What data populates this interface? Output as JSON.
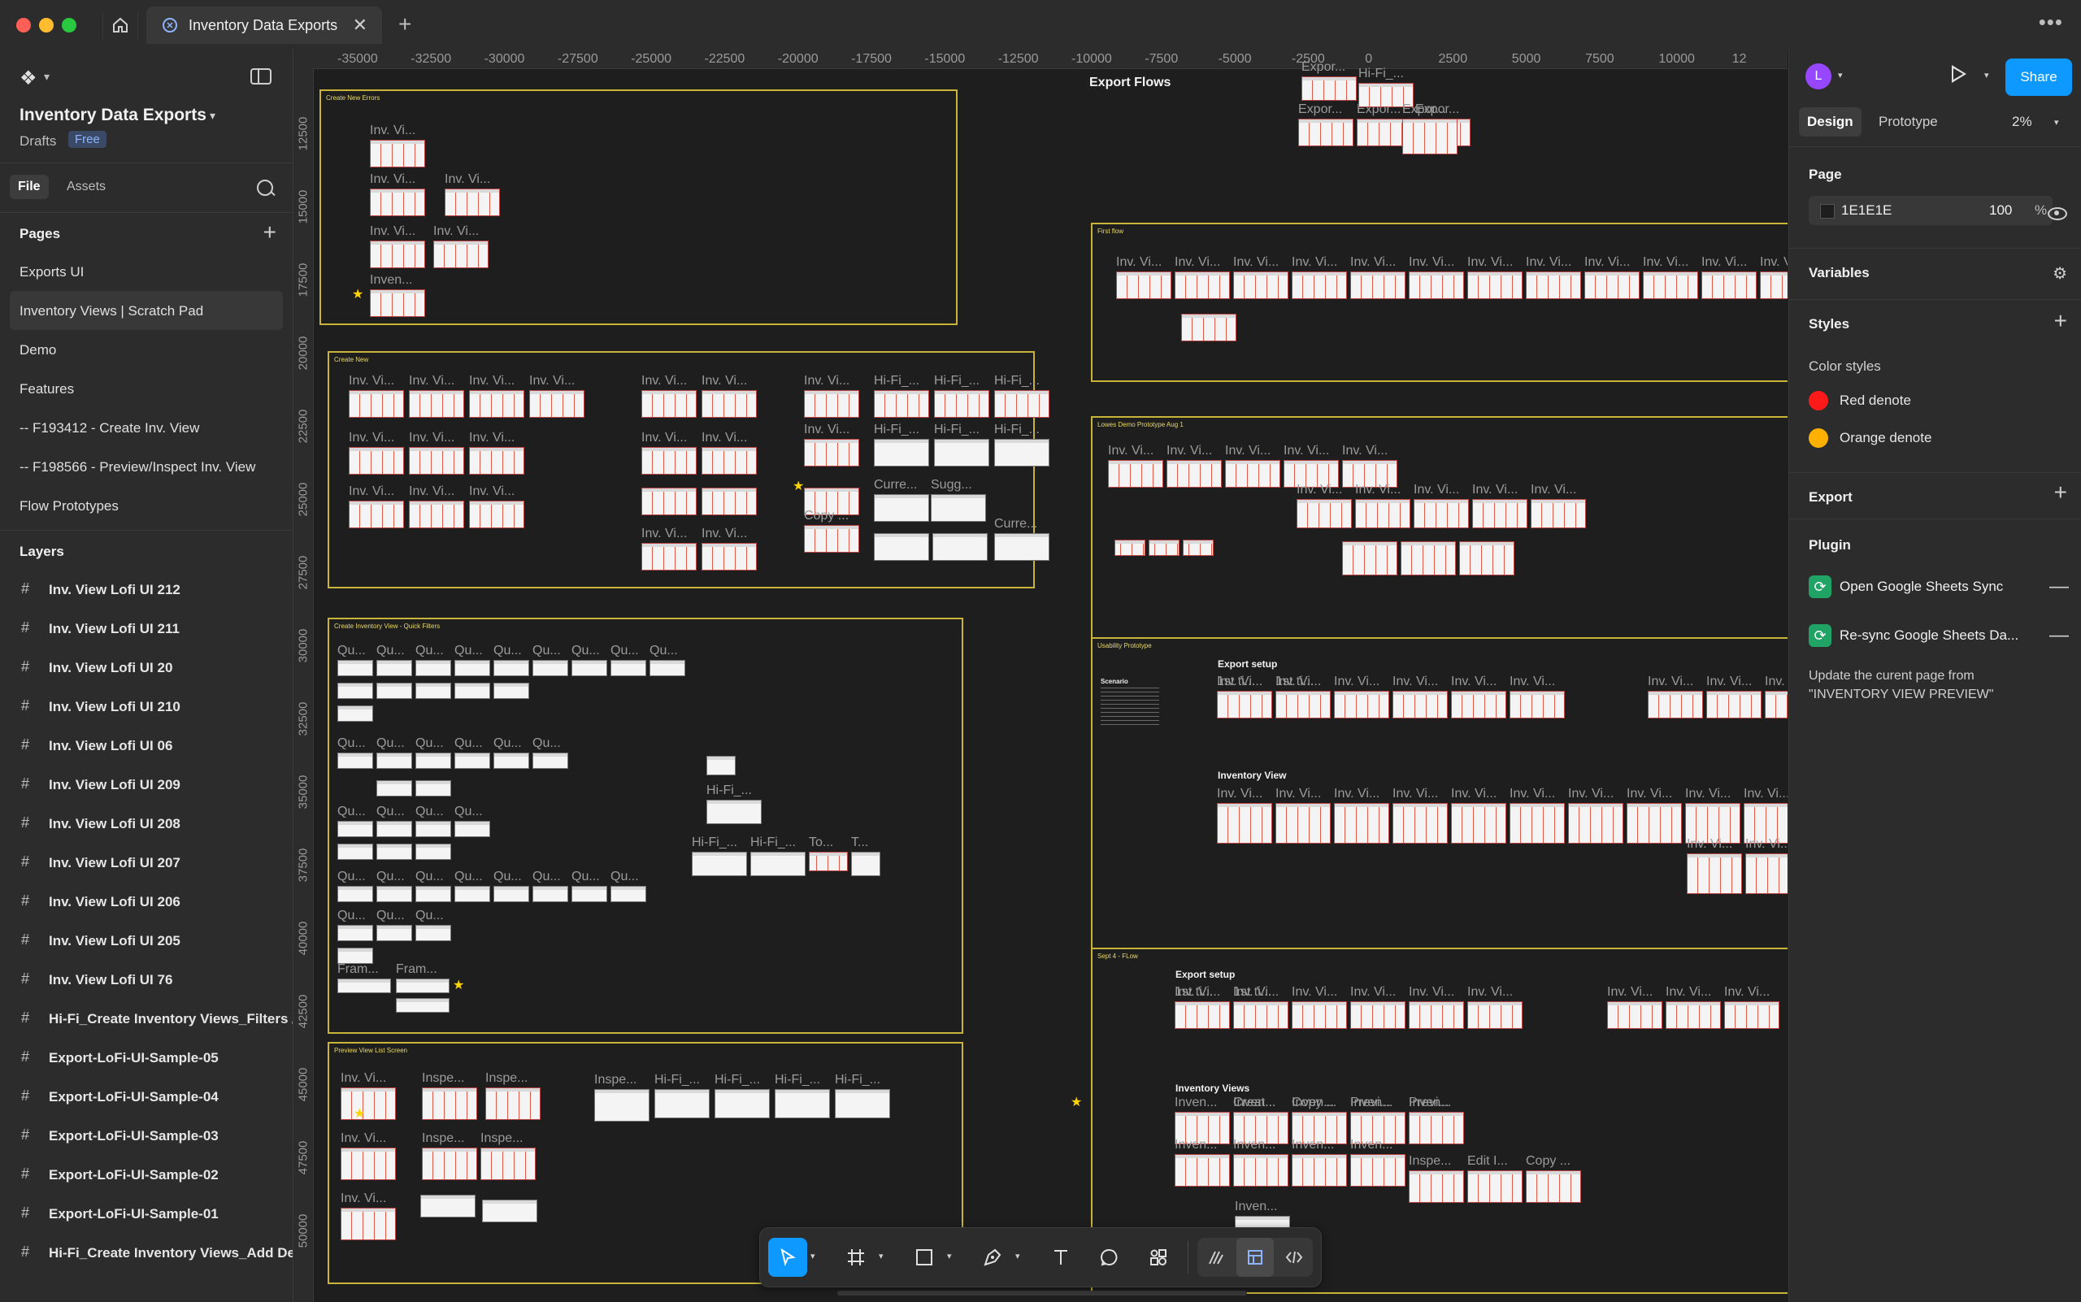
{
  "window": {
    "tab_title": "Inventory Data Exports"
  },
  "file": {
    "title": "Inventory Data Exports",
    "location": "Drafts",
    "plan_badge": "Free"
  },
  "left_tabs": {
    "file": "File",
    "assets": "Assets"
  },
  "pages": {
    "heading": "Pages",
    "items": [
      "Exports UI",
      "Inventory Views | Scratch Pad",
      "Demo",
      "Features",
      "-- F193412 - Create Inv. View",
      "-- F198566 - Preview/Inspect Inv. View",
      "Flow Prototypes"
    ],
    "selected_index": 1
  },
  "layers": {
    "heading": "Layers",
    "items": [
      "Inv. View Lofi UI 212",
      "Inv. View Lofi UI 211",
      "Inv. View Lofi UI 20",
      "Inv. View Lofi UI 210",
      "Inv. View Lofi UI 06",
      "Inv. View Lofi UI 209",
      "Inv. View Lofi UI 208",
      "Inv. View Lofi UI 207",
      "Inv. View Lofi UI 206",
      "Inv. View Lofi UI 205",
      "Inv. View Lofi UI 76",
      "Hi-Fi_Create Inventory Views_Filters /",
      "Export-LoFi-UI-Sample-05",
      "Export-LoFi-UI-Sample-04",
      "Export-LoFi-UI-Sample-03",
      "Export-LoFi-UI-Sample-02",
      "Export-LoFi-UI-Sample-01",
      "Hi-Fi_Create Inventory Views_Add De"
    ]
  },
  "ruler": {
    "x_ticks": [
      "-35000",
      "-32500",
      "-30000",
      "-27500",
      "-25000",
      "-22500",
      "-20000",
      "-17500",
      "-15000",
      "-12500",
      "-10000",
      "-7500",
      "-5000",
      "-2500",
      "0",
      "2500",
      "5000",
      "7500",
      "10000",
      "12"
    ],
    "y_ticks": [
      "12500",
      "15000",
      "17500",
      "20000",
      "22500",
      "25000",
      "27500",
      "30000",
      "32500",
      "35000",
      "37500",
      "40000",
      "42500",
      "45000",
      "47500",
      "50000"
    ]
  },
  "canvas": {
    "frames": {
      "create_new_errors": "Create New Errors",
      "create_new": "Create New",
      "quick_filters": "Create Inventory View - Quick Filters",
      "preview_list": "Preview View List Screen",
      "first_flow": "First flow",
      "lowes_demo": "Lowes Demo Prototype Aug 1",
      "usability": "Usability Prototype",
      "sept_flow": "Sept 4 - FLow"
    },
    "headings": {
      "export_flows": "Export Flows",
      "export_setup_1": "Export setup",
      "inventory_view": "Inventory View",
      "export_setup_2": "Export setup",
      "inventory_views": "Inventory Views",
      "scenario": "Scenario"
    },
    "thumb_labels": {
      "inv": "Inv. Vi...",
      "inven": "Inven...",
      "qu": "Qu...",
      "hifi": "Hi-Fi_...",
      "fram": "Fram...",
      "curre": "Curre...",
      "sugg": "Sugg...",
      "copy": "Copy ...",
      "inspe": "Inspe...",
      "expor": "Expor...",
      "first": "1st ti...",
      "creat": "Creat...",
      "previ": "Previ...",
      "edit": "Edit I...",
      "to": "To...",
      "t": "T..."
    }
  },
  "toolbar": {
    "tools": [
      "move-tool",
      "frame-tool",
      "rectangle-tool",
      "pen-tool",
      "text-tool",
      "comment-tool",
      "actions-tool",
      "draw-mode",
      "design-mode",
      "dev-mode"
    ],
    "active": "move-tool"
  },
  "right": {
    "avatar_initial": "L",
    "share_label": "Share",
    "tabs": {
      "design": "Design",
      "prototype": "Prototype"
    },
    "zoom": "2%",
    "page": {
      "heading": "Page",
      "bg_hex": "1E1E1E",
      "opacity": "100",
      "percent_sign": "%"
    },
    "variables_heading": "Variables",
    "styles": {
      "heading": "Styles",
      "color_styles_label": "Color styles",
      "items": [
        {
          "name": "Red denote",
          "color": "#ff1a1a"
        },
        {
          "name": "Orange denote",
          "color": "#ffb000"
        }
      ]
    },
    "export_heading": "Export",
    "plugin": {
      "heading": "Plugin",
      "items": [
        "Open Google Sheets Sync",
        "Re-sync Google Sheets Da..."
      ],
      "description": "Update the curent page from \"INVENTORY VIEW PREVIEW\""
    }
  },
  "help_label": "?"
}
